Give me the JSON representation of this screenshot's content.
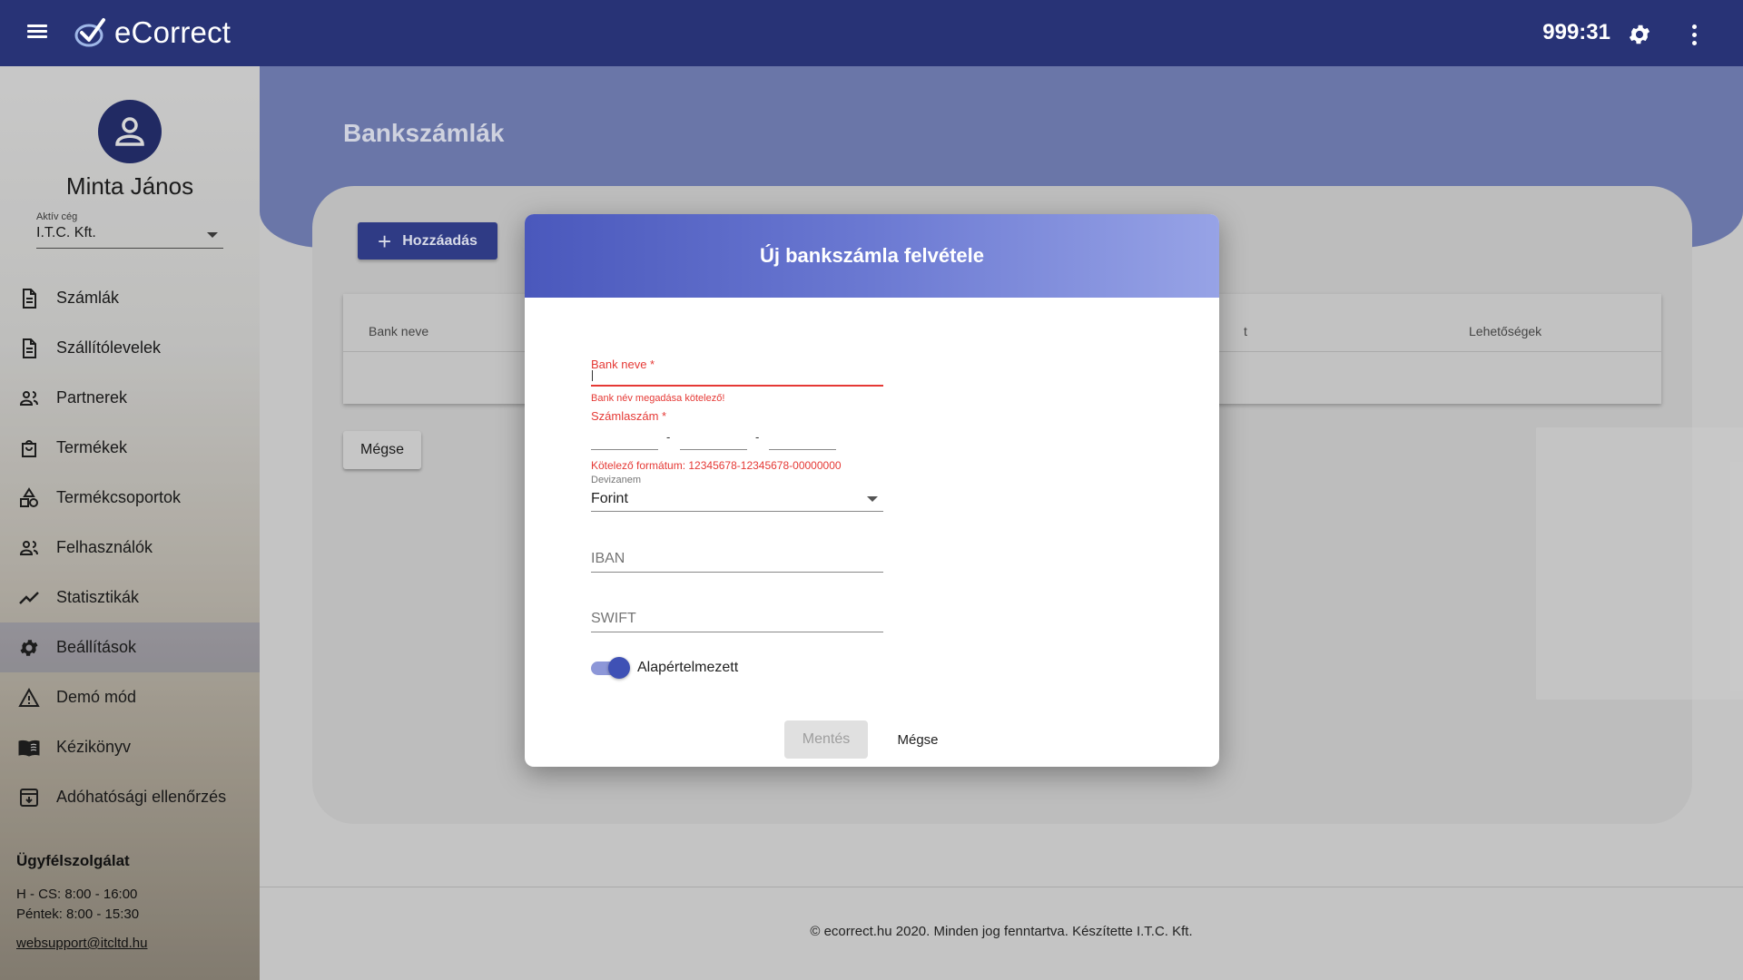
{
  "app": {
    "name": "eCorrect",
    "timer": "999:31"
  },
  "sidebar": {
    "user_name": "Minta János",
    "company_label": "Aktív cég",
    "company_value": "I.T.C. Kft.",
    "items": [
      {
        "label": "Számlák",
        "icon": "document-icon"
      },
      {
        "label": "Szállítólevelek",
        "icon": "document-icon"
      },
      {
        "label": "Partnerek",
        "icon": "people-icon"
      },
      {
        "label": "Termékek",
        "icon": "shopping-bag-icon"
      },
      {
        "label": "Termékcsoportok",
        "icon": "category-icon"
      },
      {
        "label": "Felhasználók",
        "icon": "people-icon"
      },
      {
        "label": "Statisztikák",
        "icon": "trending-icon"
      },
      {
        "label": "Beállítások",
        "icon": "gear-icon"
      },
      {
        "label": "Demó mód",
        "icon": "warning-icon"
      },
      {
        "label": "Kézikönyv",
        "icon": "book-icon"
      },
      {
        "label": "Adóhatósági ellenőrzés",
        "icon": "archive-icon"
      }
    ],
    "active_item": "Beállítások",
    "support": {
      "title": "Ügyfélszolgálat",
      "hours_1": "H - CS: 8:00 - 16:00",
      "hours_2": "Péntek: 8:00 - 15:30",
      "email": "websupport@itcltd.hu"
    }
  },
  "page": {
    "title": "Bankszámlák",
    "add_button": "Hozzáadás",
    "table_headers": {
      "bank_name": "Bank neve",
      "partial": "t",
      "options": "Lehetőségek"
    },
    "cancel_button": "Mégse",
    "footer": "© ecorrect.hu 2020. Minden jog fenntartva. Készítette I.T.C. Kft."
  },
  "modal": {
    "title": "Új bankszámla felvétele",
    "bank_name_label": "Bank neve *",
    "bank_name_error": "Bank név megadása kötelező!",
    "account_label": "Számlaszám *",
    "account_separator": "-",
    "account_error": "Kötelező formátum: 12345678-12345678-00000000",
    "currency_label": "Devizanem",
    "currency_value": "Forint",
    "iban_placeholder": "IBAN",
    "swift_placeholder": "SWIFT",
    "default_toggle_label": "Alapértelmezett",
    "default_toggle_on": true,
    "save_button": "Mentés",
    "cancel_button": "Mégse"
  },
  "colors": {
    "topbar": "#283376",
    "accent": "#3f51b5",
    "error": "#e53935"
  }
}
